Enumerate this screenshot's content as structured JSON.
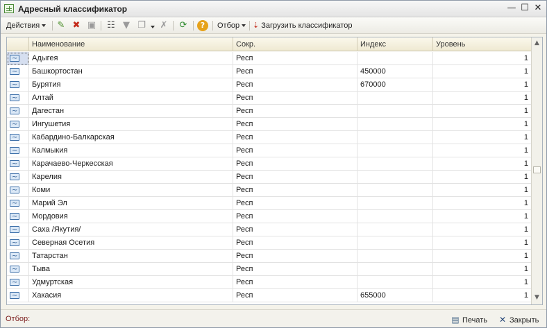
{
  "window": {
    "title": "Адресный классификатор"
  },
  "toolbar": {
    "actions_label": "Действия",
    "filter_label": "Отбор",
    "load_label": "Загрузить классификатор",
    "help_icon": "?"
  },
  "table": {
    "headers": [
      "Наименование",
      "Сокр.",
      "Индекс",
      "Уровень"
    ],
    "rows": [
      {
        "name": "Адыгея",
        "abbr": "Респ",
        "index": "",
        "level": "1"
      },
      {
        "name": "Башкортостан",
        "abbr": "Респ",
        "index": "450000",
        "level": "1"
      },
      {
        "name": "Бурятия",
        "abbr": "Респ",
        "index": "670000",
        "level": "1"
      },
      {
        "name": "Алтай",
        "abbr": "Респ",
        "index": "",
        "level": "1"
      },
      {
        "name": "Дагестан",
        "abbr": "Респ",
        "index": "",
        "level": "1"
      },
      {
        "name": "Ингушетия",
        "abbr": "Респ",
        "index": "",
        "level": "1"
      },
      {
        "name": "Кабардино-Балкарская",
        "abbr": "Респ",
        "index": "",
        "level": "1"
      },
      {
        "name": "Калмыкия",
        "abbr": "Респ",
        "index": "",
        "level": "1"
      },
      {
        "name": "Карачаево-Черкесская",
        "abbr": "Респ",
        "index": "",
        "level": "1"
      },
      {
        "name": "Карелия",
        "abbr": "Респ",
        "index": "",
        "level": "1"
      },
      {
        "name": "Коми",
        "abbr": "Респ",
        "index": "",
        "level": "1"
      },
      {
        "name": "Марий Эл",
        "abbr": "Респ",
        "index": "",
        "level": "1"
      },
      {
        "name": "Мордовия",
        "abbr": "Респ",
        "index": "",
        "level": "1"
      },
      {
        "name": "Саха /Якутия/",
        "abbr": "Респ",
        "index": "",
        "level": "1"
      },
      {
        "name": "Северная Осетия",
        "abbr": "Респ",
        "index": "",
        "level": "1"
      },
      {
        "name": "Татарстан",
        "abbr": "Респ",
        "index": "",
        "level": "1"
      },
      {
        "name": "Тыва",
        "abbr": "Респ",
        "index": "",
        "level": "1"
      },
      {
        "name": "Удмуртская",
        "abbr": "Респ",
        "index": "",
        "level": "1"
      },
      {
        "name": "Хакасия",
        "abbr": "Респ",
        "index": "655000",
        "level": "1"
      }
    ]
  },
  "status": {
    "filter_label": "Отбор:",
    "print_label": "Печать",
    "close_label": "Закрыть"
  },
  "colors": {
    "title_bg": "#ececec",
    "header_bg": "#f5f0dc",
    "filter_text": "#7a1a1a",
    "row_icon": "#3b6ea8"
  }
}
